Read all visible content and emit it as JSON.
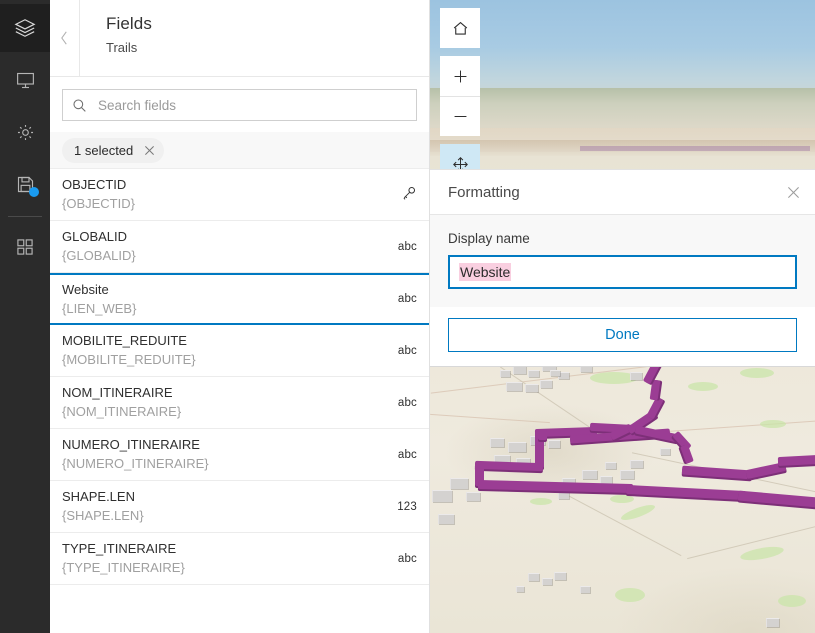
{
  "rail": {
    "items": [
      {
        "name": "layers",
        "icon": "layers-icon",
        "active": true,
        "badge": false
      },
      {
        "name": "slides",
        "icon": "presentation-icon",
        "active": false,
        "badge": false
      },
      {
        "name": "settings",
        "icon": "gear-icon",
        "active": false,
        "badge": false
      },
      {
        "name": "save",
        "icon": "save-icon",
        "active": false,
        "badge": true
      },
      {
        "name": "apps",
        "icon": "grid-apps-icon",
        "active": false,
        "badge": false
      }
    ]
  },
  "fields_panel": {
    "back_label": "‹",
    "title": "Fields",
    "subtitle": "Trails",
    "search": {
      "placeholder": "Search fields",
      "value": ""
    },
    "selection": {
      "label": "1 selected",
      "clear_label": "×"
    },
    "fields": [
      {
        "name": "OBJECTID",
        "alias": "{OBJECTID}",
        "type": "key",
        "type_label": "",
        "selected": false
      },
      {
        "name": "GLOBALID",
        "alias": "{GLOBALID}",
        "type": "string",
        "type_label": "abc",
        "selected": false
      },
      {
        "name": "Website",
        "alias": "{LIEN_WEB}",
        "type": "string",
        "type_label": "abc",
        "selected": true
      },
      {
        "name": "MOBILITE_REDUITE",
        "alias": "{MOBILITE_REDUITE}",
        "type": "string",
        "type_label": "abc",
        "selected": false
      },
      {
        "name": "NOM_ITINERAIRE",
        "alias": "{NOM_ITINERAIRE}",
        "type": "string",
        "type_label": "abc",
        "selected": false
      },
      {
        "name": "NUMERO_ITINERAIRE",
        "alias": "{NUMERO_ITINERAIRE}",
        "type": "string",
        "type_label": "abc",
        "selected": false
      },
      {
        "name": "SHAPE.LEN",
        "alias": "{SHAPE.LEN}",
        "type": "number",
        "type_label": "123",
        "selected": false
      },
      {
        "name": "TYPE_ITINERAIRE",
        "alias": "{TYPE_ITINERAIRE}",
        "type": "string",
        "type_label": "abc",
        "selected": false
      }
    ]
  },
  "map": {
    "controls": [
      {
        "name": "home",
        "icon": "home-icon",
        "active": false
      },
      {
        "name": "zoom-in",
        "icon": "plus-icon",
        "active": false
      },
      {
        "name": "zoom-out",
        "icon": "minus-icon",
        "active": false
      },
      {
        "name": "pan",
        "icon": "pan-icon",
        "active": true
      }
    ]
  },
  "formatting": {
    "title": "Formatting",
    "close_label": "×",
    "display_name_label": "Display name",
    "display_name_value": "Website",
    "done_label": "Done"
  },
  "colors": {
    "accent_blue": "#0079c1",
    "badge_blue": "#1a9bf0",
    "selection_pink": "#f9cfe0",
    "trail_purple": "#9b3d94",
    "rail_bg": "#2b2b2b"
  }
}
